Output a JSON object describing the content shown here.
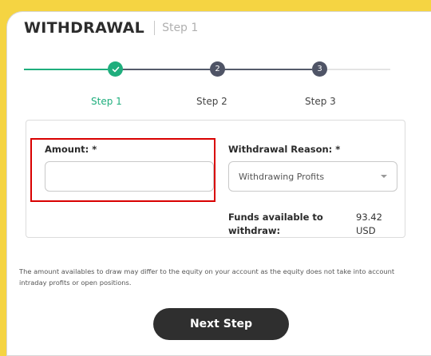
{
  "header": {
    "title": "WITHDRAWAL",
    "subtitle": "Step 1"
  },
  "stepper": {
    "steps": [
      {
        "label": "Step 1",
        "number": "",
        "status": "done"
      },
      {
        "label": "Step 2",
        "number": "2",
        "status": "pending"
      },
      {
        "label": "Step 3",
        "number": "3",
        "status": "pending"
      }
    ]
  },
  "form": {
    "amount_label": "Amount: *",
    "amount_value": "",
    "reason_label": "Withdrawal Reason: *",
    "reason_value": "Withdrawing Profits",
    "funds_label": "Funds available to withdraw:",
    "funds_value": "93.42 USD"
  },
  "note": "The amount availables to draw may differ to the equity on your account as the equity does not take into account intraday profits or open positions.",
  "actions": {
    "next_label": "Next Step"
  },
  "colors": {
    "accent": "#1fae7d",
    "pending": "#4f5466",
    "highlight": "#d90000",
    "button": "#2f2f2f",
    "background": "#f5d442"
  }
}
